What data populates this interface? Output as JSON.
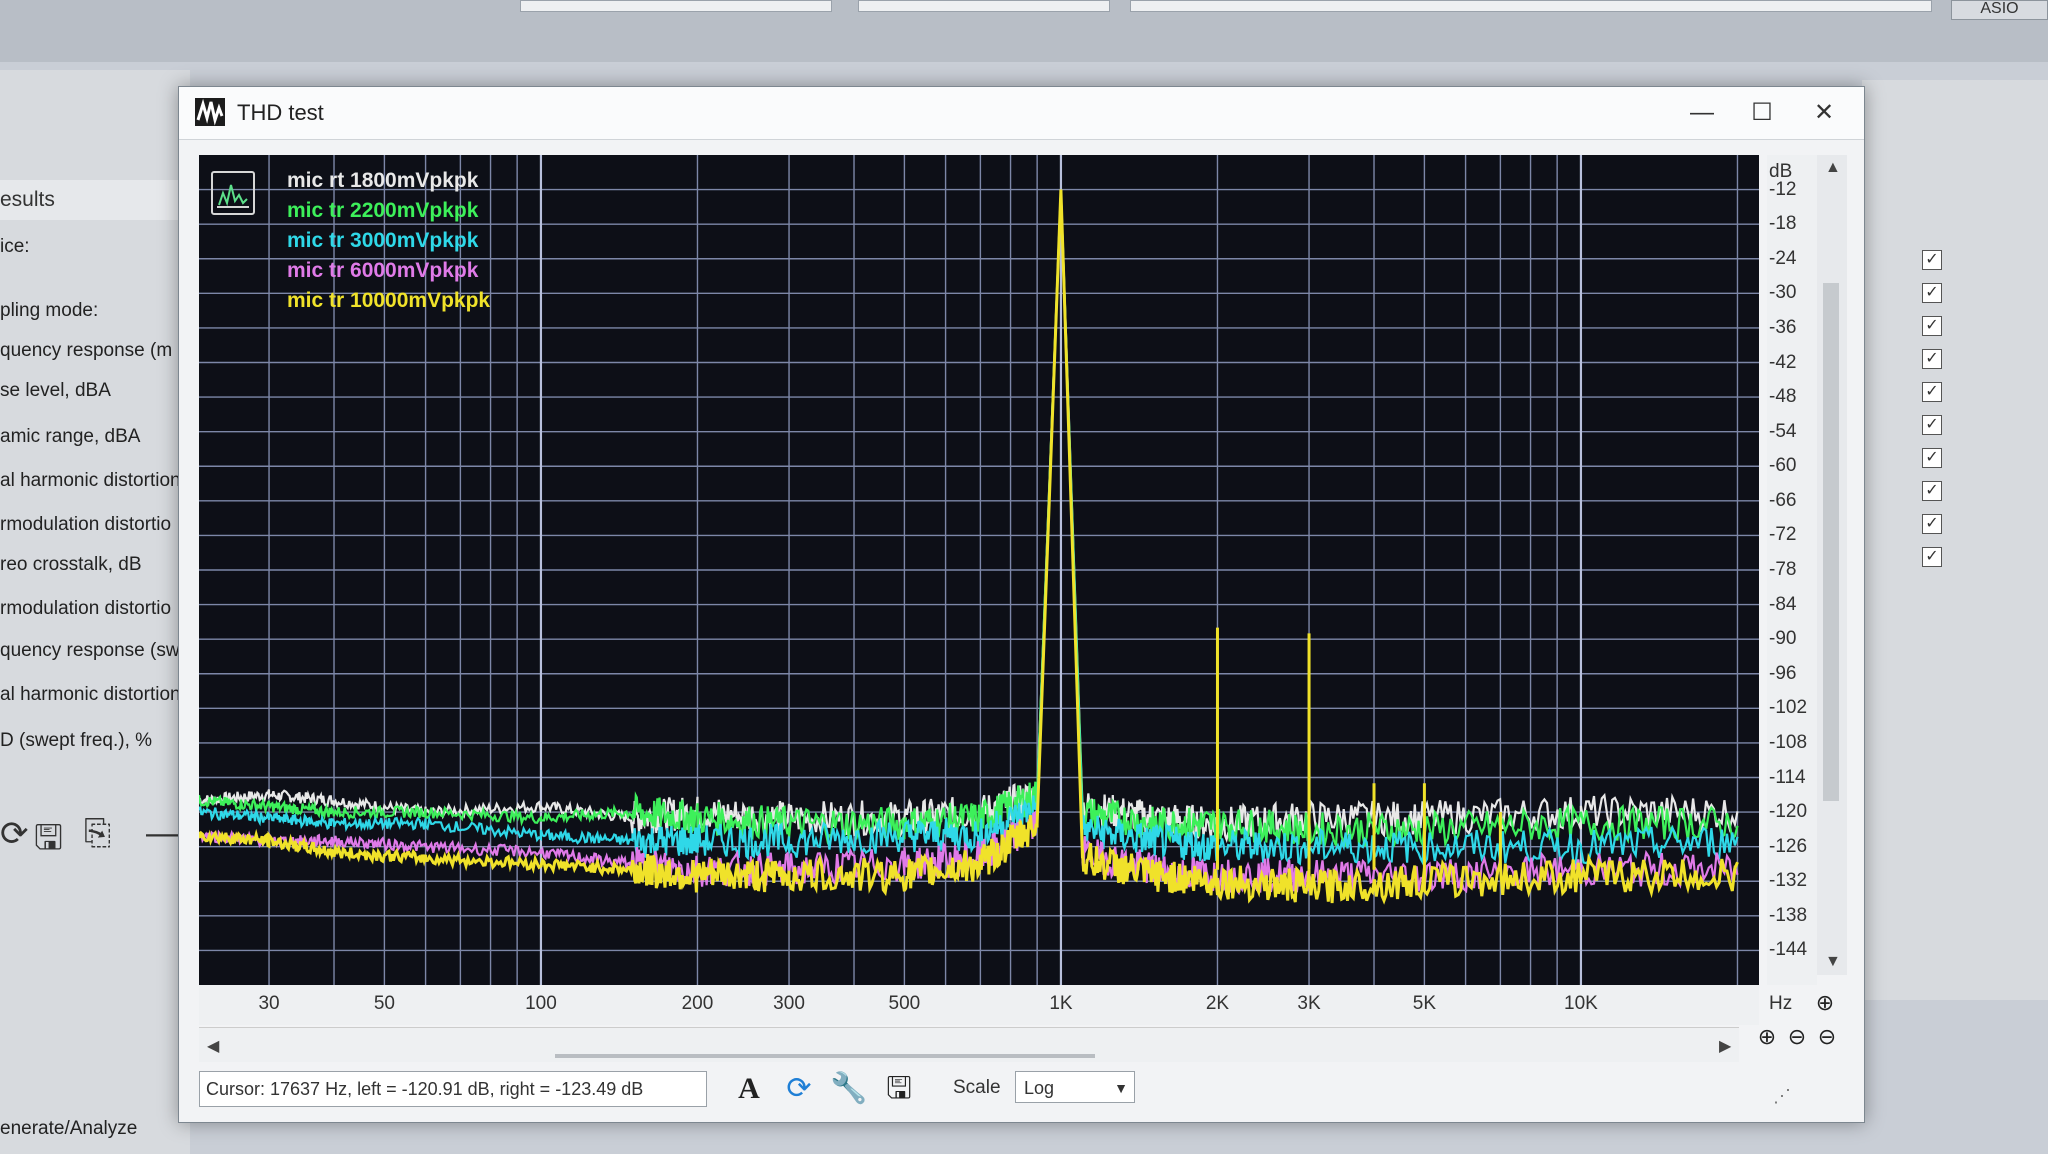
{
  "background": {
    "asio_label": "ASIO",
    "results_label": "esults",
    "rows": [
      "ice:",
      "pling mode:",
      "quency response (m",
      "se level, dBA",
      "amic range, dBA",
      "al harmonic distortion",
      "rmodulation distortio",
      "reo crosstalk, dB",
      "rmodulation distortio",
      "quency response (sw",
      "al harmonic distortion",
      "D (swept freq.), %"
    ],
    "generate_label": "enerate/Analyze",
    "checkbox_count": 10
  },
  "window": {
    "title": "THD test",
    "minimize": "—",
    "maximize": "☐",
    "close": "✕"
  },
  "legend": [
    {
      "label": "mic rt 1800mVpkpk",
      "color": "#e8e8e8"
    },
    {
      "label": "mic tr 2200mVpkpk",
      "color": "#3df05a"
    },
    {
      "label": "mic tr 3000mVpkpk",
      "color": "#2fd8e8"
    },
    {
      "label": "mic tr 6000mVpkpk",
      "color": "#e07ae8"
    },
    {
      "label": "mic tr 10000mVpkpk",
      "color": "#f0e22a"
    }
  ],
  "y_axis": {
    "unit": "dB",
    "ticks": [
      "-12",
      "-18",
      "-24",
      "-30",
      "-36",
      "-42",
      "-48",
      "-54",
      "-60",
      "-66",
      "-72",
      "-78",
      "-84",
      "-90",
      "-96",
      "-102",
      "-108",
      "-114",
      "-120",
      "-126",
      "-132",
      "-138",
      "-144"
    ]
  },
  "x_axis": {
    "unit": "Hz",
    "ticks": [
      "30",
      "50",
      "100",
      "200",
      "300",
      "500",
      "1K",
      "2K",
      "3K",
      "5K",
      "10K"
    ]
  },
  "chart_data": {
    "type": "line",
    "xlabel": "Hz",
    "ylabel": "dB",
    "x_scale": "log",
    "xlim": [
      22,
      22000
    ],
    "ylim": [
      -150,
      -6
    ],
    "grid": true,
    "legend_placement": "top-left",
    "fundamental_hz": 1000,
    "series": [
      {
        "name": "mic rt 1800mVpkpk",
        "color": "#e8e8e8",
        "points": [
          [
            22,
            -118
          ],
          [
            30,
            -117
          ],
          [
            40,
            -118
          ],
          [
            60,
            -120
          ],
          [
            100,
            -119
          ],
          [
            150,
            -121
          ],
          [
            200,
            -120
          ],
          [
            300,
            -121
          ],
          [
            500,
            -121
          ],
          [
            700,
            -120
          ],
          [
            900,
            -117
          ],
          [
            1000,
            -12
          ],
          [
            1100,
            -119
          ],
          [
            1500,
            -121
          ],
          [
            2000,
            -122
          ],
          [
            3000,
            -121
          ],
          [
            5000,
            -121
          ],
          [
            10000,
            -120
          ],
          [
            20000,
            -120
          ]
        ]
      },
      {
        "name": "mic tr 2200mVpkpk",
        "color": "#3df05a",
        "points": [
          [
            22,
            -118
          ],
          [
            30,
            -119
          ],
          [
            40,
            -120
          ],
          [
            60,
            -120
          ],
          [
            100,
            -121
          ],
          [
            150,
            -120
          ],
          [
            200,
            -121
          ],
          [
            300,
            -122
          ],
          [
            500,
            -122
          ],
          [
            700,
            -121
          ],
          [
            900,
            -117
          ],
          [
            1000,
            -12
          ],
          [
            1100,
            -120
          ],
          [
            1500,
            -122
          ],
          [
            2000,
            -122
          ],
          [
            3000,
            -123
          ],
          [
            5000,
            -123
          ],
          [
            10000,
            -122
          ],
          [
            20000,
            -122
          ]
        ]
      },
      {
        "name": "mic tr 3000mVpkpk",
        "color": "#2fd8e8",
        "points": [
          [
            22,
            -120
          ],
          [
            30,
            -121
          ],
          [
            40,
            -122
          ],
          [
            60,
            -122
          ],
          [
            100,
            -124
          ],
          [
            150,
            -125
          ],
          [
            200,
            -125
          ],
          [
            300,
            -125
          ],
          [
            500,
            -124
          ],
          [
            700,
            -124
          ],
          [
            900,
            -119
          ],
          [
            1000,
            -12
          ],
          [
            1100,
            -123
          ],
          [
            1500,
            -125
          ],
          [
            2000,
            -126
          ],
          [
            3000,
            -126
          ],
          [
            5000,
            -126
          ],
          [
            10000,
            -126
          ],
          [
            20000,
            -125
          ]
        ]
      },
      {
        "name": "mic tr 6000mVpkpk",
        "color": "#e07ae8",
        "points": [
          [
            22,
            -124
          ],
          [
            30,
            -125
          ],
          [
            40,
            -125
          ],
          [
            60,
            -126
          ],
          [
            100,
            -127
          ],
          [
            150,
            -129
          ],
          [
            200,
            -130
          ],
          [
            300,
            -130
          ],
          [
            500,
            -129
          ],
          [
            700,
            -128
          ],
          [
            900,
            -122
          ],
          [
            1000,
            -12
          ],
          [
            1100,
            -127
          ],
          [
            1500,
            -130
          ],
          [
            2000,
            -131
          ],
          [
            3000,
            -131
          ],
          [
            5000,
            -131
          ],
          [
            10000,
            -130
          ],
          [
            20000,
            -130
          ]
        ]
      },
      {
        "name": "mic tr 10000mVpkpk",
        "color": "#f0e22a",
        "points": [
          [
            22,
            -124
          ],
          [
            30,
            -125
          ],
          [
            40,
            -127
          ],
          [
            60,
            -128
          ],
          [
            100,
            -129
          ],
          [
            150,
            -130
          ],
          [
            200,
            -131
          ],
          [
            300,
            -131
          ],
          [
            500,
            -131
          ],
          [
            700,
            -129
          ],
          [
            900,
            -122
          ],
          [
            1000,
            -12
          ],
          [
            1100,
            -128
          ],
          [
            1500,
            -131
          ],
          [
            2000,
            -132
          ],
          [
            3000,
            -133
          ],
          [
            5000,
            -132
          ],
          [
            10000,
            -131
          ],
          [
            20000,
            -131
          ]
        ]
      }
    ],
    "harmonics": [
      {
        "x": 2000,
        "y": -88,
        "color": "#f0e22a"
      },
      {
        "x": 3000,
        "y": -89,
        "color": "#f0e22a"
      },
      {
        "x": 4000,
        "y": -115,
        "color": "#f0e22a"
      },
      {
        "x": 5000,
        "y": -115,
        "color": "#f0e22a"
      },
      {
        "x": 7000,
        "y": -120,
        "color": "#f0e22a"
      }
    ]
  },
  "zoom_buttons": {
    "zoom_in": "⊕",
    "zoom_out": "⊖",
    "zoom_reset": "⊖"
  },
  "status": {
    "cursor_text": "Cursor:  17637 Hz,  left = -120.91 dB,  right = -123.49 dB",
    "scale_label": "Scale",
    "scale_value": "Log"
  }
}
